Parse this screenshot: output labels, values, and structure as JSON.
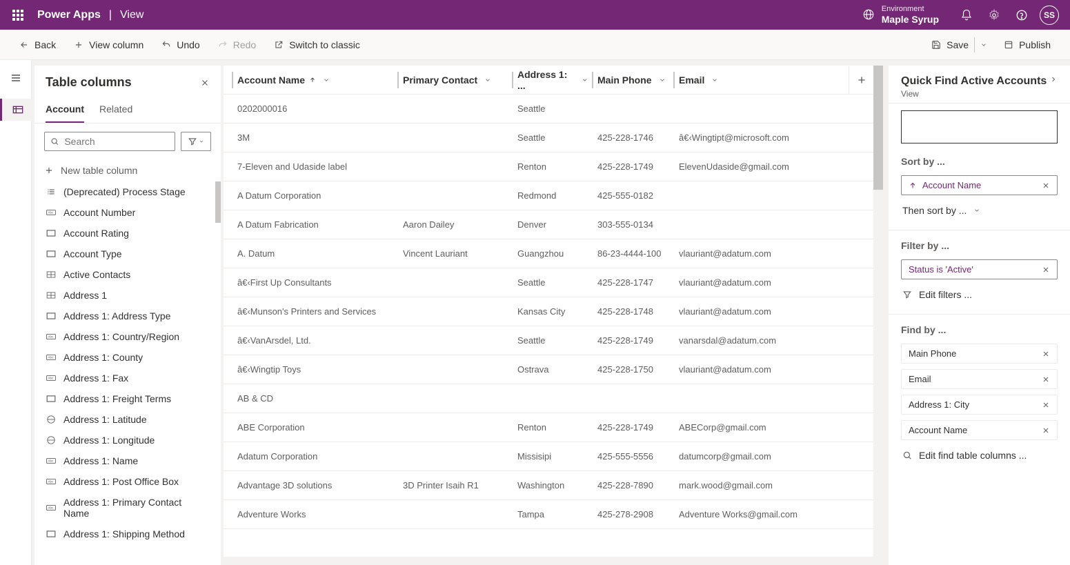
{
  "header": {
    "app": "Power Apps",
    "page": "View",
    "env_label": "Environment",
    "env_name": "Maple Syrup",
    "avatar": "SS"
  },
  "commands": {
    "back": "Back",
    "view_column": "View column",
    "undo": "Undo",
    "redo": "Redo",
    "switch": "Switch to classic",
    "save": "Save",
    "publish": "Publish"
  },
  "left": {
    "title": "Table columns",
    "tab_account": "Account",
    "tab_related": "Related",
    "search_ph": "Search",
    "new_col": "New table column",
    "columns": [
      "(Deprecated) Process Stage",
      "Account Number",
      "Account Rating",
      "Account Type",
      "Active Contacts",
      "Address 1",
      "Address 1: Address Type",
      "Address 1: Country/Region",
      "Address 1: County",
      "Address 1: Fax",
      "Address 1: Freight Terms",
      "Address 1: Latitude",
      "Address 1: Longitude",
      "Address 1: Name",
      "Address 1: Post Office Box",
      "Address 1: Primary Contact Name",
      "Address 1: Shipping Method"
    ]
  },
  "grid": {
    "headers": {
      "c1": "Account Name",
      "c2": "Primary Contact",
      "c3": "Address 1: ...",
      "c4": "Main Phone",
      "c5": "Email"
    },
    "rows": [
      {
        "name": "0202000016",
        "contact": "",
        "city": "Seattle",
        "phone": "",
        "email": ""
      },
      {
        "name": "3M",
        "contact": "",
        "city": "Seattle",
        "phone": "425-228-1746",
        "email": "â€‹Wingtipt@microsoft.com"
      },
      {
        "name": "7-Eleven and Udaside label",
        "contact": "",
        "city": "Renton",
        "phone": "425-228-1749",
        "email": "ElevenUdaside@gmail.com"
      },
      {
        "name": "A Datum Corporation",
        "contact": "",
        "city": "Redmond",
        "phone": "425-555-0182",
        "email": ""
      },
      {
        "name": "A Datum Fabrication",
        "contact": "Aaron Dailey",
        "city": "Denver",
        "phone": "303-555-0134",
        "email": ""
      },
      {
        "name": "A. Datum",
        "contact": "Vincent Lauriant",
        "city": "Guangzhou",
        "phone": "86-23-4444-100",
        "email": "vlauriant@adatum.com"
      },
      {
        "name": "â€‹First Up Consultants",
        "contact": "",
        "city": "Seattle",
        "phone": "425-228-1747",
        "email": "vlauriant@adatum.com"
      },
      {
        "name": "â€‹Munson's Printers and Services",
        "contact": "",
        "city": "Kansas City",
        "phone": "425-228-1748",
        "email": "vlauriant@adatum.com"
      },
      {
        "name": "â€‹VanArsdel, Ltd.",
        "contact": "",
        "city": "Seattle",
        "phone": "425-228-1749",
        "email": "vanarsdal@adatum.com"
      },
      {
        "name": "â€‹Wingtip Toys",
        "contact": "",
        "city": "Ostrava",
        "phone": "425-228-1750",
        "email": "vlauriant@adatum.com"
      },
      {
        "name": "AB & CD",
        "contact": "",
        "city": "",
        "phone": "",
        "email": ""
      },
      {
        "name": "ABE Corporation",
        "contact": "",
        "city": "Renton",
        "phone": "425-228-1749",
        "email": "ABECorp@gmail.com"
      },
      {
        "name": "Adatum Corporation",
        "contact": "",
        "city": "Missisipi",
        "phone": "425-555-5556",
        "email": "datumcorp@gmail.com"
      },
      {
        "name": "Advantage 3D solutions",
        "contact": "3D Printer Isaih R1",
        "city": "Washington",
        "phone": "425-228-7890",
        "email": "mark.wood@gmail.com"
      },
      {
        "name": "Adventure Works",
        "contact": "",
        "city": "Tampa",
        "phone": "425-278-2908",
        "email": "Adventure Works@gmail.com"
      }
    ]
  },
  "right": {
    "title": "Quick Find Active Accounts",
    "sub": "View",
    "sort_label": "Sort by ...",
    "sort_main": "Account Name",
    "then_sort": "Then sort by ...",
    "filter_label": "Filter by ...",
    "filter_main": "Status is 'Active'",
    "edit_filters": "Edit filters ...",
    "find_label": "Find by ...",
    "find": [
      "Main Phone",
      "Email",
      "Address 1: City",
      "Account Name"
    ],
    "edit_find": "Edit find table columns ..."
  }
}
